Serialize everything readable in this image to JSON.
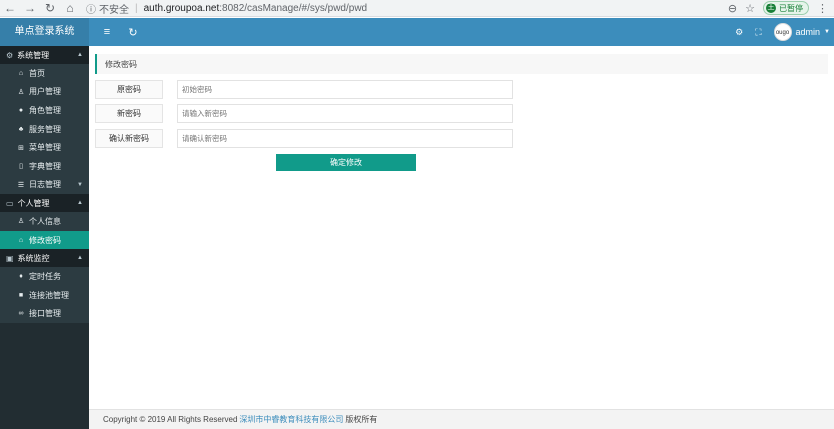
{
  "browser": {
    "url_security": "不安全",
    "url_host": "auth.groupoa.net",
    "url_path": ":8082/casManage/#/sys/pwd/pwd",
    "profile_initial": "王",
    "profile_status": "已暂停"
  },
  "header": {
    "app_title": "单点登录系统",
    "avatar_text": "ougo",
    "user_name": "admin"
  },
  "sidebar": {
    "groups": [
      {
        "label": "系统管理",
        "items": [
          {
            "label": "首页"
          },
          {
            "label": "用户管理"
          },
          {
            "label": "角色管理"
          },
          {
            "label": "服务管理"
          },
          {
            "label": "菜单管理"
          },
          {
            "label": "字典管理"
          },
          {
            "label": "日志管理"
          }
        ]
      },
      {
        "label": "个人管理",
        "items": [
          {
            "label": "个人信息"
          },
          {
            "label": "修改密码"
          }
        ]
      },
      {
        "label": "系统监控",
        "items": [
          {
            "label": "定时任务"
          },
          {
            "label": "连接池管理"
          },
          {
            "label": "接口管理"
          }
        ]
      }
    ]
  },
  "main": {
    "title": "修改密码",
    "form": {
      "old_label": "原密码",
      "old_placeholder": "初始密码",
      "new_label": "新密码",
      "new_placeholder": "请输入新密码",
      "confirm_label": "确认新密码",
      "confirm_placeholder": "请确认新密码",
      "submit_label": "确定修改"
    }
  },
  "footer": {
    "prefix": "Copyright © 2019 All Rights Reserved",
    "company": "深圳市中睿教育科技有限公司",
    "suffix": "版权所有"
  }
}
